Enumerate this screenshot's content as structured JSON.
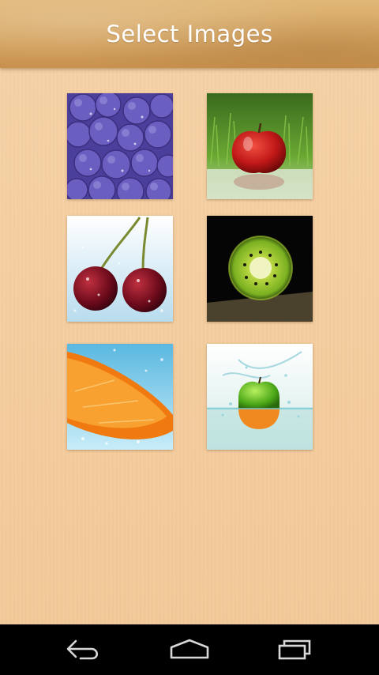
{
  "header": {
    "title": "Select Images"
  },
  "images": [
    {
      "name": "blueberries",
      "icon": "blueberries-image"
    },
    {
      "name": "red-apple",
      "icon": "red-apple-image"
    },
    {
      "name": "cherries",
      "icon": "cherries-image"
    },
    {
      "name": "kiwi",
      "icon": "kiwi-image"
    },
    {
      "name": "orange",
      "icon": "orange-slice-image"
    },
    {
      "name": "green-apple",
      "icon": "green-apple-splash-image"
    }
  ],
  "nav": {
    "back_icon": "back-icon",
    "home_icon": "home-icon",
    "recents_icon": "recents-icon"
  },
  "colors": {
    "background": "#f4cea0",
    "title_bar": "#d5a562",
    "nav_bar": "#000000"
  }
}
